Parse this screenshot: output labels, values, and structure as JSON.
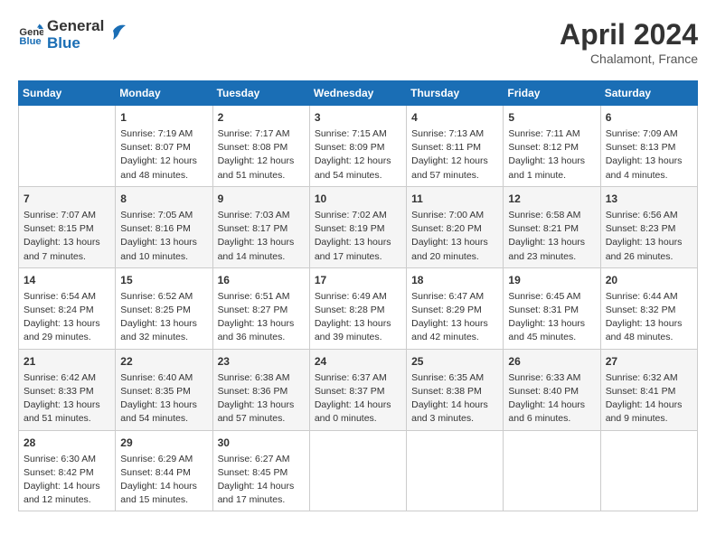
{
  "header": {
    "logo_line1": "General",
    "logo_line2": "Blue",
    "month": "April 2024",
    "location": "Chalamont, France"
  },
  "columns": [
    "Sunday",
    "Monday",
    "Tuesday",
    "Wednesday",
    "Thursday",
    "Friday",
    "Saturday"
  ],
  "weeks": [
    [
      {
        "day": "",
        "sunrise": "",
        "sunset": "",
        "daylight": ""
      },
      {
        "day": "1",
        "sunrise": "Sunrise: 7:19 AM",
        "sunset": "Sunset: 8:07 PM",
        "daylight": "Daylight: 12 hours and 48 minutes."
      },
      {
        "day": "2",
        "sunrise": "Sunrise: 7:17 AM",
        "sunset": "Sunset: 8:08 PM",
        "daylight": "Daylight: 12 hours and 51 minutes."
      },
      {
        "day": "3",
        "sunrise": "Sunrise: 7:15 AM",
        "sunset": "Sunset: 8:09 PM",
        "daylight": "Daylight: 12 hours and 54 minutes."
      },
      {
        "day": "4",
        "sunrise": "Sunrise: 7:13 AM",
        "sunset": "Sunset: 8:11 PM",
        "daylight": "Daylight: 12 hours and 57 minutes."
      },
      {
        "day": "5",
        "sunrise": "Sunrise: 7:11 AM",
        "sunset": "Sunset: 8:12 PM",
        "daylight": "Daylight: 13 hours and 1 minute."
      },
      {
        "day": "6",
        "sunrise": "Sunrise: 7:09 AM",
        "sunset": "Sunset: 8:13 PM",
        "daylight": "Daylight: 13 hours and 4 minutes."
      }
    ],
    [
      {
        "day": "7",
        "sunrise": "Sunrise: 7:07 AM",
        "sunset": "Sunset: 8:15 PM",
        "daylight": "Daylight: 13 hours and 7 minutes."
      },
      {
        "day": "8",
        "sunrise": "Sunrise: 7:05 AM",
        "sunset": "Sunset: 8:16 PM",
        "daylight": "Daylight: 13 hours and 10 minutes."
      },
      {
        "day": "9",
        "sunrise": "Sunrise: 7:03 AM",
        "sunset": "Sunset: 8:17 PM",
        "daylight": "Daylight: 13 hours and 14 minutes."
      },
      {
        "day": "10",
        "sunrise": "Sunrise: 7:02 AM",
        "sunset": "Sunset: 8:19 PM",
        "daylight": "Daylight: 13 hours and 17 minutes."
      },
      {
        "day": "11",
        "sunrise": "Sunrise: 7:00 AM",
        "sunset": "Sunset: 8:20 PM",
        "daylight": "Daylight: 13 hours and 20 minutes."
      },
      {
        "day": "12",
        "sunrise": "Sunrise: 6:58 AM",
        "sunset": "Sunset: 8:21 PM",
        "daylight": "Daylight: 13 hours and 23 minutes."
      },
      {
        "day": "13",
        "sunrise": "Sunrise: 6:56 AM",
        "sunset": "Sunset: 8:23 PM",
        "daylight": "Daylight: 13 hours and 26 minutes."
      }
    ],
    [
      {
        "day": "14",
        "sunrise": "Sunrise: 6:54 AM",
        "sunset": "Sunset: 8:24 PM",
        "daylight": "Daylight: 13 hours and 29 minutes."
      },
      {
        "day": "15",
        "sunrise": "Sunrise: 6:52 AM",
        "sunset": "Sunset: 8:25 PM",
        "daylight": "Daylight: 13 hours and 32 minutes."
      },
      {
        "day": "16",
        "sunrise": "Sunrise: 6:51 AM",
        "sunset": "Sunset: 8:27 PM",
        "daylight": "Daylight: 13 hours and 36 minutes."
      },
      {
        "day": "17",
        "sunrise": "Sunrise: 6:49 AM",
        "sunset": "Sunset: 8:28 PM",
        "daylight": "Daylight: 13 hours and 39 minutes."
      },
      {
        "day": "18",
        "sunrise": "Sunrise: 6:47 AM",
        "sunset": "Sunset: 8:29 PM",
        "daylight": "Daylight: 13 hours and 42 minutes."
      },
      {
        "day": "19",
        "sunrise": "Sunrise: 6:45 AM",
        "sunset": "Sunset: 8:31 PM",
        "daylight": "Daylight: 13 hours and 45 minutes."
      },
      {
        "day": "20",
        "sunrise": "Sunrise: 6:44 AM",
        "sunset": "Sunset: 8:32 PM",
        "daylight": "Daylight: 13 hours and 48 minutes."
      }
    ],
    [
      {
        "day": "21",
        "sunrise": "Sunrise: 6:42 AM",
        "sunset": "Sunset: 8:33 PM",
        "daylight": "Daylight: 13 hours and 51 minutes."
      },
      {
        "day": "22",
        "sunrise": "Sunrise: 6:40 AM",
        "sunset": "Sunset: 8:35 PM",
        "daylight": "Daylight: 13 hours and 54 minutes."
      },
      {
        "day": "23",
        "sunrise": "Sunrise: 6:38 AM",
        "sunset": "Sunset: 8:36 PM",
        "daylight": "Daylight: 13 hours and 57 minutes."
      },
      {
        "day": "24",
        "sunrise": "Sunrise: 6:37 AM",
        "sunset": "Sunset: 8:37 PM",
        "daylight": "Daylight: 14 hours and 0 minutes."
      },
      {
        "day": "25",
        "sunrise": "Sunrise: 6:35 AM",
        "sunset": "Sunset: 8:38 PM",
        "daylight": "Daylight: 14 hours and 3 minutes."
      },
      {
        "day": "26",
        "sunrise": "Sunrise: 6:33 AM",
        "sunset": "Sunset: 8:40 PM",
        "daylight": "Daylight: 14 hours and 6 minutes."
      },
      {
        "day": "27",
        "sunrise": "Sunrise: 6:32 AM",
        "sunset": "Sunset: 8:41 PM",
        "daylight": "Daylight: 14 hours and 9 minutes."
      }
    ],
    [
      {
        "day": "28",
        "sunrise": "Sunrise: 6:30 AM",
        "sunset": "Sunset: 8:42 PM",
        "daylight": "Daylight: 14 hours and 12 minutes."
      },
      {
        "day": "29",
        "sunrise": "Sunrise: 6:29 AM",
        "sunset": "Sunset: 8:44 PM",
        "daylight": "Daylight: 14 hours and 15 minutes."
      },
      {
        "day": "30",
        "sunrise": "Sunrise: 6:27 AM",
        "sunset": "Sunset: 8:45 PM",
        "daylight": "Daylight: 14 hours and 17 minutes."
      },
      {
        "day": "",
        "sunrise": "",
        "sunset": "",
        "daylight": ""
      },
      {
        "day": "",
        "sunrise": "",
        "sunset": "",
        "daylight": ""
      },
      {
        "day": "",
        "sunrise": "",
        "sunset": "",
        "daylight": ""
      },
      {
        "day": "",
        "sunrise": "",
        "sunset": "",
        "daylight": ""
      }
    ]
  ]
}
